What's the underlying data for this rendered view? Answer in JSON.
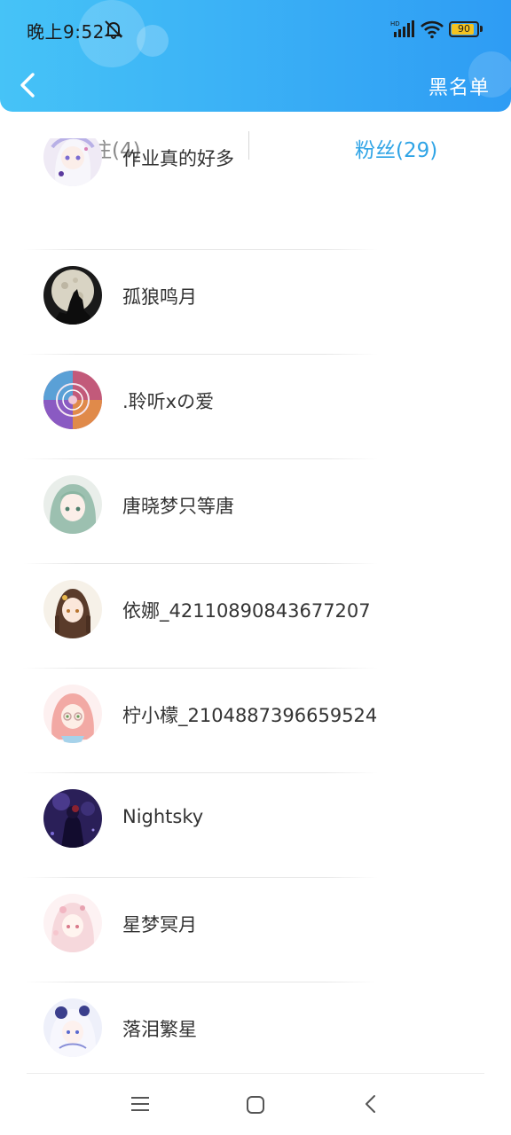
{
  "status_bar": {
    "time": "晚上9:52",
    "battery": "90",
    "battery_level": 0.9,
    "battery_color": "#f4c320"
  },
  "header": {
    "back_icon": "chevron-left-icon",
    "right_action": "黑名单",
    "gradient_start": "#46c3f7",
    "gradient_end": "#2e9cf4"
  },
  "tabs": {
    "following": "关注(4)",
    "fans": "粉丝(29)",
    "active": "fans",
    "active_color": "#2fa4e6",
    "inactive_color": "#8a8a8a"
  },
  "fans": [
    {
      "name": "作业真的好多",
      "avatar": "anime-girl-white-hair-avatar"
    },
    {
      "name": "孤狼鸣月",
      "avatar": "wolf-howling-moon-avatar"
    },
    {
      "name": ".聆听xの爱",
      "avatar": "colorful-anime-collage-avatar"
    },
    {
      "name": "唐晓梦只等唐",
      "avatar": "anime-girl-green-hair-avatar"
    },
    {
      "name": "依娜_42110890843677207",
      "avatar": "anime-girl-braids-avatar"
    },
    {
      "name": "柠小檬_2104887396659524",
      "avatar": "anime-girl-pink-hair-avatar"
    },
    {
      "name": "Nightsky",
      "avatar": "dark-purple-night-avatar"
    },
    {
      "name": "星梦冥月",
      "avatar": "anime-girl-pastel-avatar"
    },
    {
      "name": "落泪繁星",
      "avatar": "anime-girl-blue-white-avatar"
    }
  ],
  "system_nav": {
    "menu_icon": "menu-icon",
    "home_icon": "home-icon",
    "back_icon": "back-triangle-icon"
  }
}
